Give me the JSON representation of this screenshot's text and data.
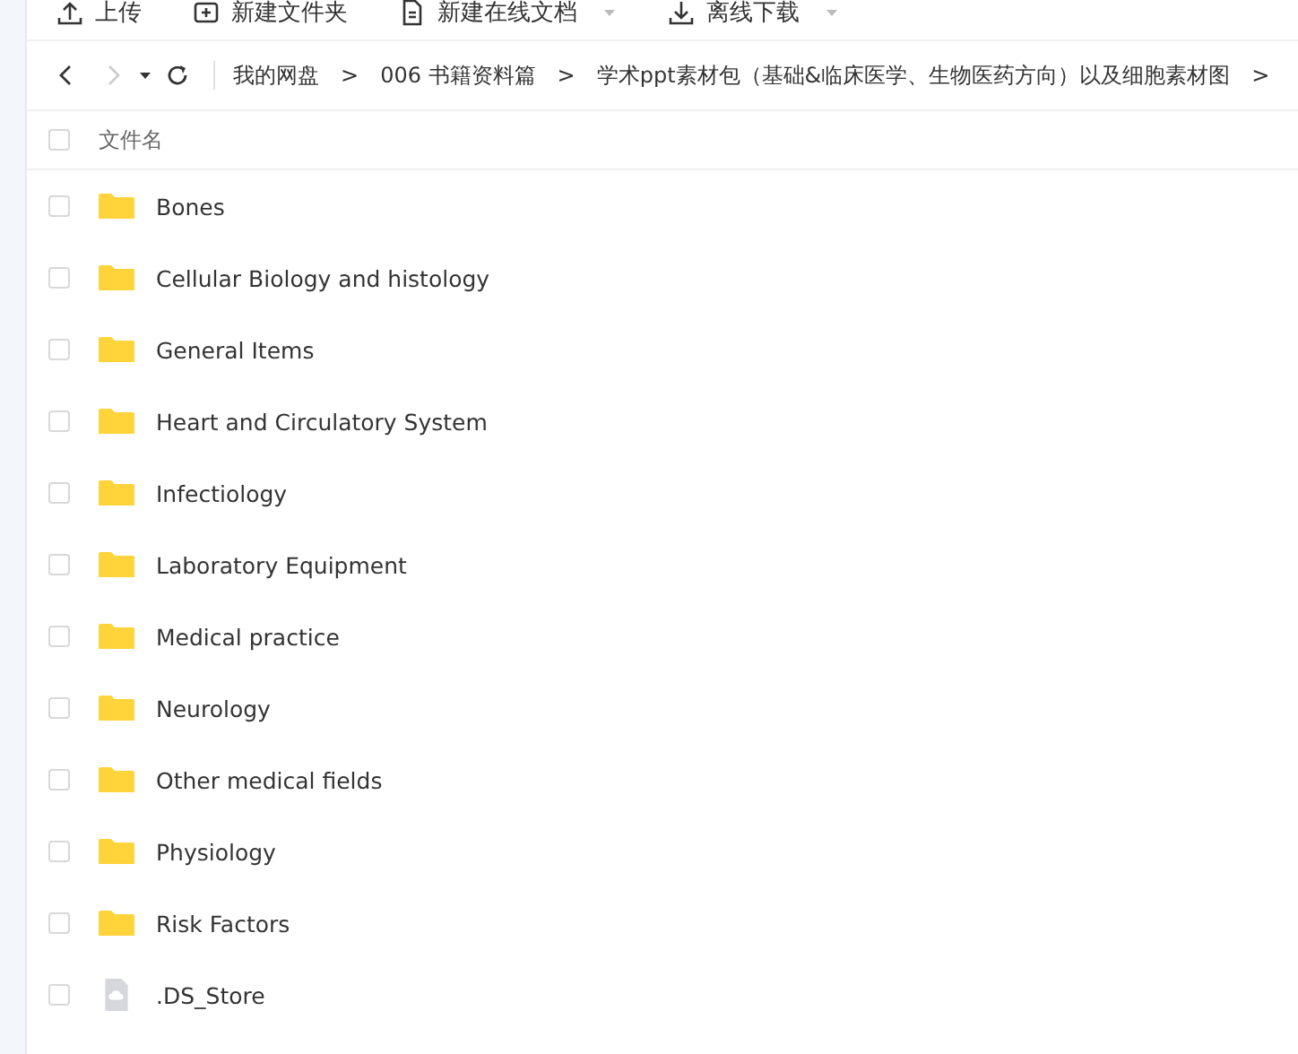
{
  "toolbar": [
    {
      "label": "上传",
      "kind": "upload",
      "dropdown": false
    },
    {
      "label": "新建文件夹",
      "kind": "folder",
      "dropdown": false
    },
    {
      "label": "新建在线文档",
      "kind": "document",
      "dropdown": true
    },
    {
      "label": "离线下载",
      "kind": "download",
      "dropdown": true
    }
  ],
  "breadcrumb": {
    "back_disabled": false,
    "forward_disabled": true,
    "items": [
      "我的网盘",
      "006 书籍资料篇",
      "学术ppt素材包（基础&临床医学、生物医药方向）以及细胞素材图"
    ],
    "separator": ">"
  },
  "header": {
    "checked": false,
    "column": "文件名"
  },
  "files": [
    {
      "name": "Bones",
      "kind": "folder",
      "checked": false
    },
    {
      "name": "Cellular Biology and histology",
      "kind": "folder",
      "checked": false
    },
    {
      "name": "General Items",
      "kind": "folder",
      "checked": false
    },
    {
      "name": "Heart and Circulatory System",
      "kind": "folder",
      "checked": false
    },
    {
      "name": "Infectiology",
      "kind": "folder",
      "checked": false
    },
    {
      "name": "Laboratory Equipment",
      "kind": "folder",
      "checked": false
    },
    {
      "name": "Medical practice",
      "kind": "folder",
      "checked": false
    },
    {
      "name": "Neurology",
      "kind": "folder",
      "checked": false
    },
    {
      "name": "Other medical fields",
      "kind": "folder",
      "checked": false
    },
    {
      "name": "Physiology",
      "kind": "folder",
      "checked": false
    },
    {
      "name": "Risk Factors",
      "kind": "folder",
      "checked": false
    },
    {
      "name": ".DS_Store",
      "kind": "file",
      "checked": false
    }
  ]
}
